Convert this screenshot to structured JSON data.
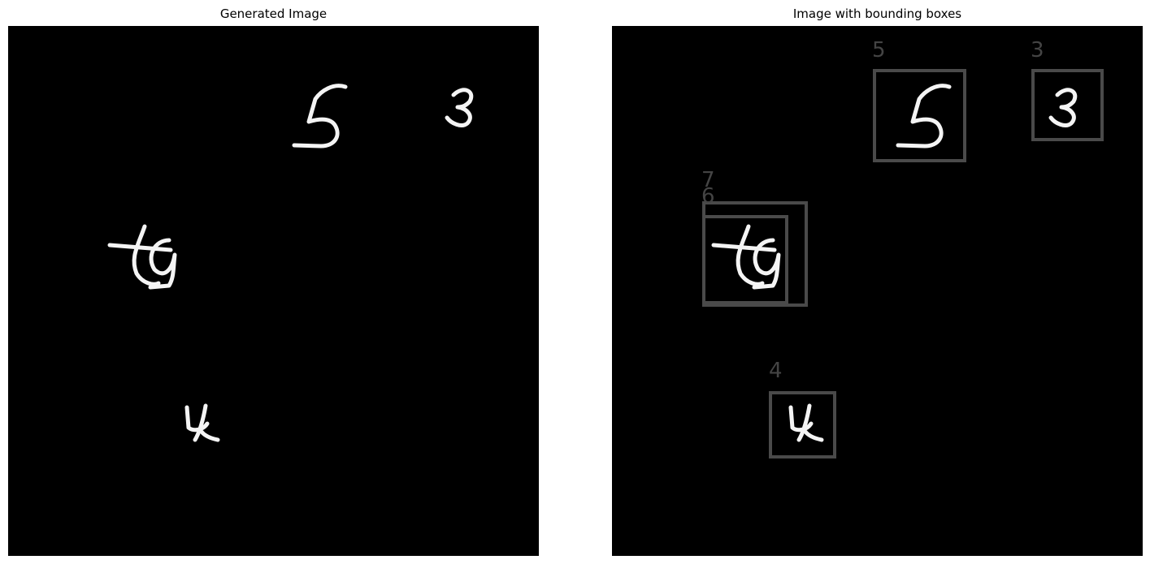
{
  "figure": {
    "left_title": "Generated Image",
    "right_title": "Image with bounding boxes"
  },
  "colors": {
    "canvas_background": "#000000",
    "digit_stroke": "#f4f4f4",
    "box_stroke": "#4a4a4a",
    "box_label": "#444444"
  },
  "digits": [
    {
      "label": "5",
      "icon": "handwritten-digit-5"
    },
    {
      "label": "3",
      "icon": "handwritten-digit-3"
    },
    {
      "label": "7",
      "icon": "handwritten-digit-7"
    },
    {
      "label": "6",
      "icon": "handwritten-digit-6"
    },
    {
      "label": "4",
      "icon": "handwritten-digit-4"
    }
  ],
  "bounding_box_labels": [
    "5",
    "3",
    "7",
    "6",
    "4"
  ]
}
